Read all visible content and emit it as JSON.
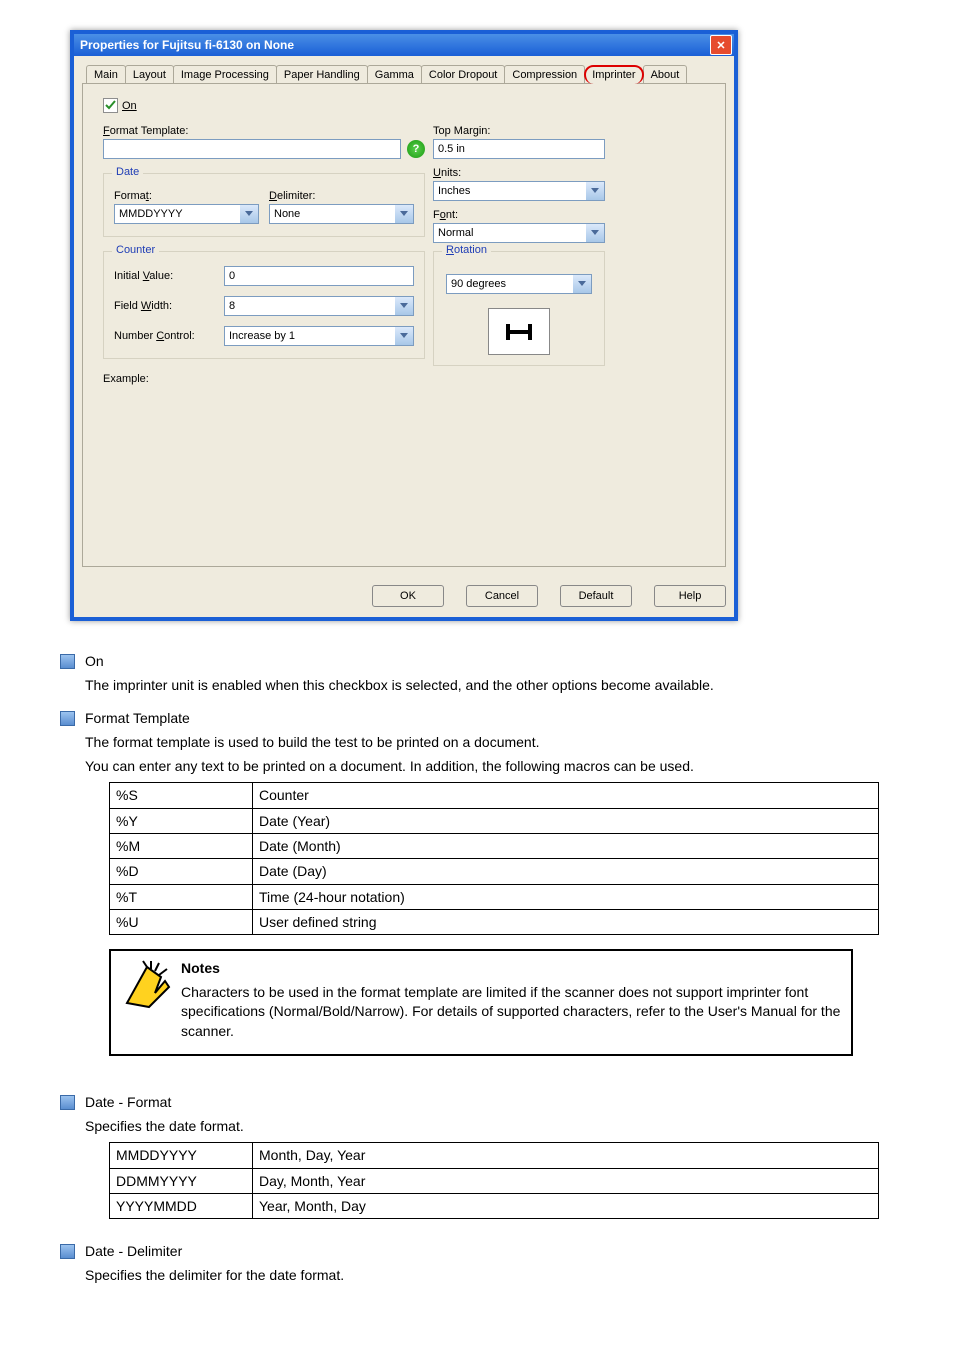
{
  "dialog": {
    "title": "Properties for Fujitsu fi-6130 on None",
    "tabs": [
      "Main",
      "Layout",
      "Image Processing",
      "Paper Handling",
      "Gamma",
      "Color Dropout",
      "Compression",
      "Imprinter",
      "About"
    ],
    "active_tab": "Imprinter",
    "on_label": "On",
    "format_template_label": "Format Template:",
    "format_template_value": "",
    "date_group": "Date",
    "format_label": "Format:",
    "format_value": "MMDDYYYY",
    "delimiter_label": "Delimiter:",
    "delimiter_value": "None",
    "counter_group": "Counter",
    "initial_value_label": "Initial Value:",
    "initial_value": "0",
    "field_width_label": "Field Width:",
    "field_width": "8",
    "number_control_label": "Number Control:",
    "number_control": "Increase by 1",
    "top_margin_label": "Top Margin:",
    "top_margin": "0.5 in",
    "units_label": "Units:",
    "units": "Inches",
    "font_label": "Font:",
    "font": "Normal",
    "rotation_group": "Rotation",
    "rotation": "90 degrees",
    "example_label": "Example:",
    "buttons": {
      "ok": "OK",
      "cancel": "Cancel",
      "default": "Default",
      "help": "Help"
    }
  },
  "doc": {
    "s1_title": "On",
    "s1_body": "The imprinter unit is enabled when this checkbox is selected, and the other options become available.",
    "s2_title": "Format Template",
    "s2_line1": "The format template is used to build the test to be printed on a document.",
    "s2_line2": "You can enter any text to be printed on a document. In addition, the following macros can be used.",
    "tbl1": [
      [
        "%S",
        "Counter"
      ],
      [
        "%Y",
        "Date (Year)"
      ],
      [
        "%M",
        "Date (Month)"
      ],
      [
        "%D",
        "Date (Day)"
      ],
      [
        "%T",
        "Time (24-hour notation)"
      ],
      [
        "%U",
        "User defined string"
      ]
    ],
    "note_heading": "Notes",
    "note_body": "Characters to be used in the format template are limited if the scanner does not support imprinter font specifications (Normal/Bold/Narrow). For details of supported characters, refer to the User's Manual for the scanner.",
    "s3_title": "Date - Format",
    "s3_body": "Specifies the date format.",
    "tbl2": [
      [
        "MMDDYYYY",
        "Month, Day, Year"
      ],
      [
        "DDMMYYYY",
        "Day, Month, Year"
      ],
      [
        "YYYYMMDD",
        "Year, Month, Day"
      ]
    ],
    "s4_title": "Date - Delimiter",
    "s4_body": "Specifies the delimiter for the date format."
  }
}
